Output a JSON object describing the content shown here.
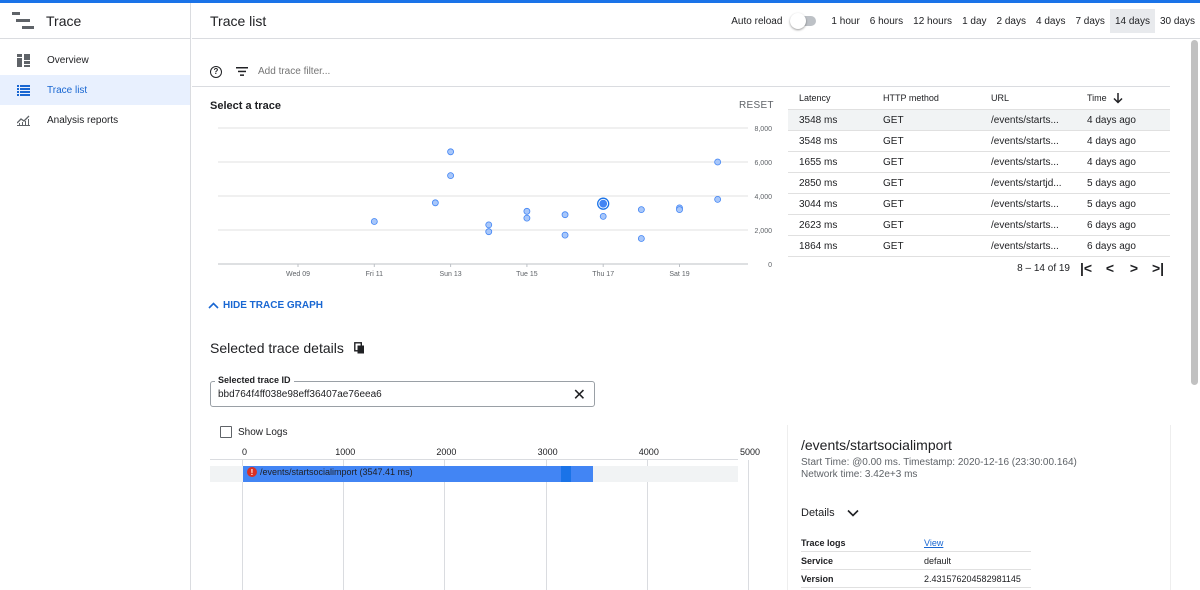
{
  "app": {
    "title": "Trace"
  },
  "sidebar": {
    "items": [
      {
        "label": "Overview",
        "icon": "dashboard-icon",
        "active": false
      },
      {
        "label": "Trace list",
        "icon": "list-icon",
        "active": true
      },
      {
        "label": "Analysis reports",
        "icon": "analytics-icon",
        "active": false
      }
    ]
  },
  "header": {
    "title": "Trace list",
    "auto_reload_label": "Auto reload",
    "ranges": [
      "1 hour",
      "6 hours",
      "12 hours",
      "1 day",
      "2 days",
      "4 days",
      "7 days",
      "14 days",
      "30 days"
    ],
    "selected_range": "14 days"
  },
  "filter": {
    "placeholder": "Add trace filter..."
  },
  "graph": {
    "title": "Select a trace",
    "reset_label": "RESET",
    "hide_label": "HIDE TRACE GRAPH"
  },
  "chart_data": {
    "type": "scatter",
    "title": "",
    "xlabel": "",
    "ylabel": "",
    "x_ticks": [
      "Wed 09",
      "Fri 11",
      "Sun 13",
      "Tue 15",
      "Thu 17",
      "Sat 19"
    ],
    "y_ticks": [
      0,
      2000,
      4000,
      6000,
      8000
    ],
    "y_tick_labels": [
      "0",
      "2,000",
      "4,000",
      "6,000",
      "8,000"
    ],
    "ylim": [
      0,
      8000
    ],
    "points": [
      {
        "day": 11.0,
        "latency": 2500
      },
      {
        "day": 12.6,
        "latency": 3600
      },
      {
        "day": 13.0,
        "latency": 6600
      },
      {
        "day": 13.0,
        "latency": 5200
      },
      {
        "day": 14.0,
        "latency": 2300
      },
      {
        "day": 14.0,
        "latency": 1900
      },
      {
        "day": 15.0,
        "latency": 3100
      },
      {
        "day": 15.0,
        "latency": 2700
      },
      {
        "day": 16.0,
        "latency": 2900
      },
      {
        "day": 16.0,
        "latency": 1700
      },
      {
        "day": 17.0,
        "latency": 3548,
        "selected": true
      },
      {
        "day": 17.0,
        "latency": 2800
      },
      {
        "day": 18.0,
        "latency": 3200
      },
      {
        "day": 18.0,
        "latency": 1500
      },
      {
        "day": 19.0,
        "latency": 3300
      },
      {
        "day": 19.0,
        "latency": 3200
      },
      {
        "day": 20.0,
        "latency": 6000
      },
      {
        "day": 20.0,
        "latency": 3800
      }
    ]
  },
  "table": {
    "columns": [
      "Latency",
      "HTTP method",
      "URL",
      "Time"
    ],
    "rows": [
      {
        "latency": "3548 ms",
        "method": "GET",
        "url": "/events/starts...",
        "time": "4 days ago",
        "highlight": true
      },
      {
        "latency": "3548 ms",
        "method": "GET",
        "url": "/events/starts...",
        "time": "4 days ago"
      },
      {
        "latency": "1655 ms",
        "method": "GET",
        "url": "/events/starts...",
        "time": "4 days ago"
      },
      {
        "latency": "2850 ms",
        "method": "GET",
        "url": "/events/startjd...",
        "time": "5 days ago"
      },
      {
        "latency": "3044 ms",
        "method": "GET",
        "url": "/events/starts...",
        "time": "5 days ago"
      },
      {
        "latency": "2623 ms",
        "method": "GET",
        "url": "/events/starts...",
        "time": "6 days ago"
      },
      {
        "latency": "1864 ms",
        "method": "GET",
        "url": "/events/starts...",
        "time": "6 days ago"
      }
    ],
    "pager_text": "8 – 14 of 19"
  },
  "details": {
    "title": "Selected trace details",
    "trace_id_label": "Selected trace ID",
    "trace_id": "bbd764f4ff038e98eff36407ae76eea6",
    "show_logs_label": "Show Logs",
    "axis_ticks": [
      "0",
      "1000",
      "2000",
      "3000",
      "4000",
      "5000"
    ],
    "span_label": "/events/startsocialimport (3547.41 ms)",
    "span_duration_ms": 3547.41
  },
  "right_panel": {
    "title": "/events/startsocialimport",
    "meta_line1": "Start Time: @0.00 ms. Timestamp: 2020-12-16 (23:30:00.164)",
    "meta_line2": "Network time: 3.42e+3 ms",
    "details_label": "Details",
    "rows": [
      {
        "key": "Trace logs",
        "value": "View",
        "link": true
      },
      {
        "key": "Service",
        "value": "default"
      },
      {
        "key": "Version",
        "value": "2.431576204582981145"
      }
    ]
  }
}
